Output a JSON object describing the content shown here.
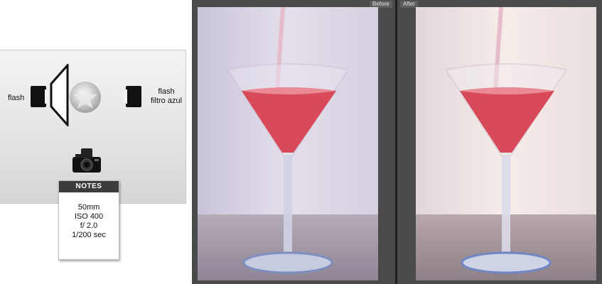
{
  "diagram": {
    "flash_left_label": "flash",
    "flash_right_label_line1": "flash",
    "flash_right_label_line2": "filtro azul"
  },
  "notes": {
    "title": "NOTES",
    "lines": [
      "50mm",
      "ISO 400",
      "f/ 2.0",
      "1/200 sec"
    ]
  },
  "viewer": {
    "before_label": "Before",
    "after_label": "After"
  },
  "colors": {
    "viewer_bg": "#4a4a4a",
    "drink": "#d84a5a",
    "before_bg": "#d9d4e4",
    "after_bg": "#f2e6e4"
  }
}
